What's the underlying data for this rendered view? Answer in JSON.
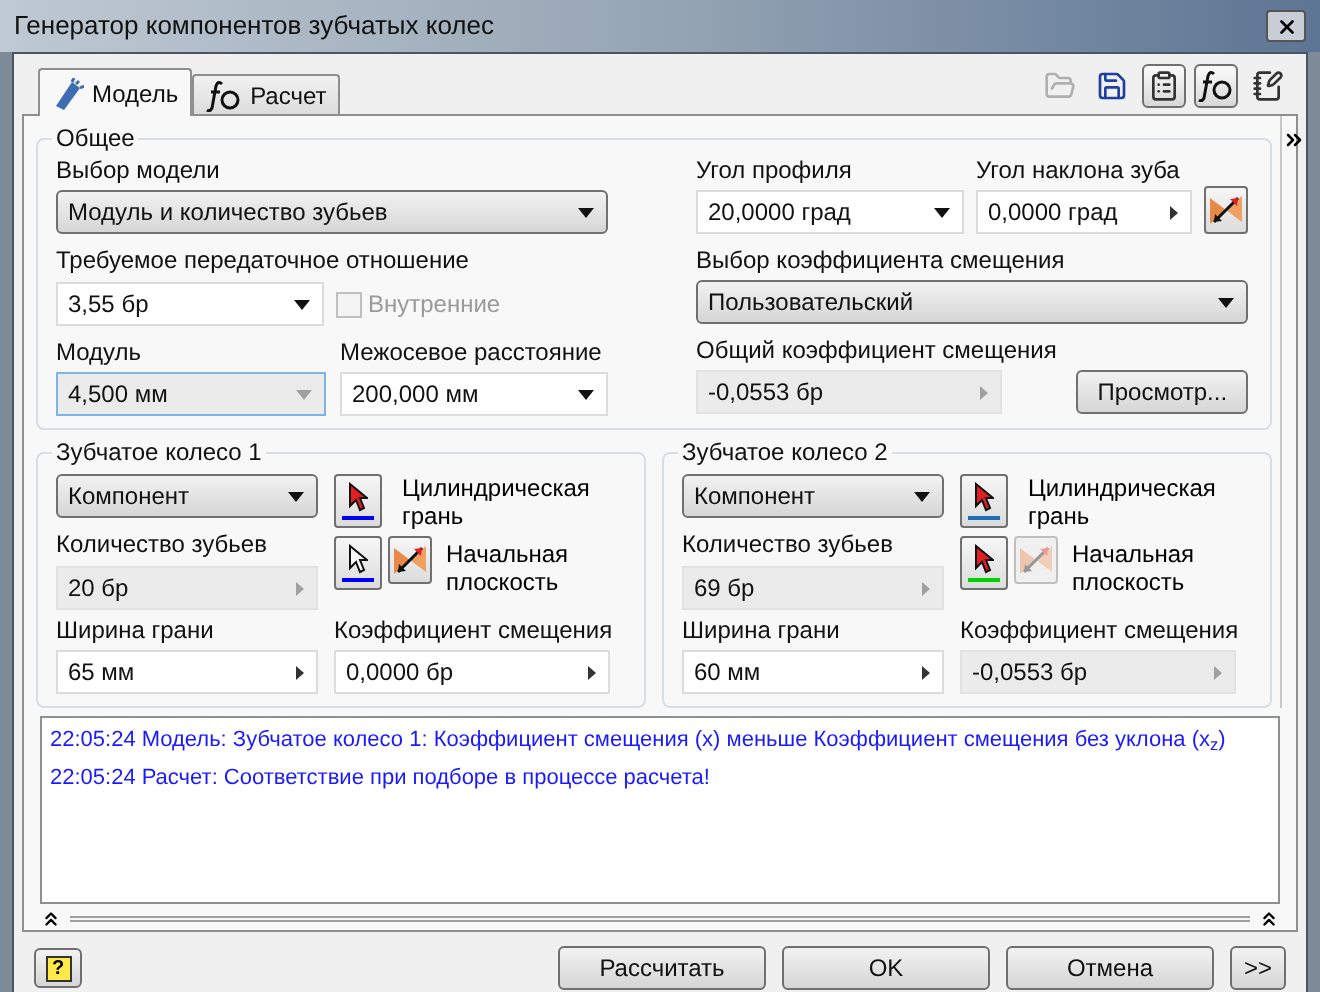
{
  "window": {
    "title": "Генератор компонентов зубчатых колес"
  },
  "tabs": [
    {
      "label": "Модель",
      "selected": true
    },
    {
      "label": "Расчет",
      "selected": false
    }
  ],
  "toolbar": [
    {
      "kind": "open",
      "disabled": true,
      "pressed": false
    },
    {
      "kind": "save",
      "disabled": false,
      "pressed": false
    },
    {
      "kind": "properties",
      "disabled": false,
      "pressed": true
    },
    {
      "kind": "fx",
      "disabled": false,
      "pressed": true
    },
    {
      "kind": "notes",
      "disabled": false,
      "pressed": false
    }
  ],
  "general": {
    "title": "Общее",
    "model": {
      "label": "Выбор модели",
      "value": "Модуль и количество зубьев",
      "kind": "select"
    },
    "ratio": {
      "label": "Требуемое передаточное отношение",
      "value": "3,55 бр",
      "kind": "combo",
      "disabled": false
    },
    "internal": {
      "label": "Внутренние",
      "checked": false,
      "disabled": true
    },
    "module": {
      "label": "Модуль",
      "value": "4,500 мм",
      "kind": "combo",
      "disabled": true
    },
    "center_distance": {
      "label": "Межосевое расстояние",
      "value": "200,000 мм",
      "kind": "combo",
      "disabled": false
    },
    "pressure_angle": {
      "label": "Угол профиля",
      "value": "20,0000 град",
      "kind": "combo",
      "disabled": false
    },
    "helix_angle": {
      "label": "Угол наклона зуба",
      "value": "0,0000 град",
      "kind": "stepper",
      "disabled": false
    },
    "shift_choice": {
      "label": "Выбор коэффициента смещения",
      "value": "Пользовательский",
      "kind": "select"
    },
    "total_shift": {
      "label": "Общий коэффициент смещения",
      "value": "-0,0553 бр",
      "kind": "stepper",
      "disabled": true
    },
    "preview_button": "Просмотр..."
  },
  "gears": [
    {
      "title": "Зубчатое колесо 1",
      "type": {
        "value": "Компонент",
        "kind": "select"
      },
      "cylinder": {
        "label": "Цилиндрическая грань",
        "active": true,
        "color": "#0000ff"
      },
      "plane": {
        "label": "Начальная плоскость",
        "active": false,
        "color": "#0000ff"
      },
      "flip_disabled": false,
      "teeth": {
        "label": "Количество зубьев",
        "value": "20 бр",
        "kind": "stepper",
        "disabled": true
      },
      "face_width": {
        "label": "Ширина грани",
        "value": "65 мм",
        "kind": "stepper",
        "disabled": false
      },
      "shift": {
        "label": "Коэффициент смещения",
        "value": "0,0000 бр",
        "kind": "stepper",
        "disabled": false
      }
    },
    {
      "title": "Зубчатое колесо 2",
      "type": {
        "value": "Компонент",
        "kind": "select"
      },
      "cylinder": {
        "label": "Цилиндрическая грань",
        "active": true,
        "color": "#1e6eb4"
      },
      "plane": {
        "label": "Начальная плоскость",
        "active": true,
        "color": "#00d000"
      },
      "flip_disabled": true,
      "teeth": {
        "label": "Количество зубьев",
        "value": "69 бр",
        "kind": "stepper",
        "disabled": true
      },
      "face_width": {
        "label": "Ширина грани",
        "value": "60 мм",
        "kind": "stepper",
        "disabled": false
      },
      "shift": {
        "label": "Коэффициент смещения",
        "value": "-0,0553 бр",
        "kind": "stepper",
        "disabled": true
      }
    }
  ],
  "messages": [
    {
      "time": "22:05:24",
      "text": "Модель: Зубчатое колесо 1: Коэффициент смещения (x) меньше Коэффициент смещения без уклона (x$_{z}$)"
    },
    {
      "time": "22:05:24",
      "text": "Расчет: Соответствие при подборе в процессе расчета!"
    }
  ],
  "help": "?",
  "buttons": [
    "Рассчитать",
    "OK",
    "Отмена"
  ],
  "more_button": ">>"
}
